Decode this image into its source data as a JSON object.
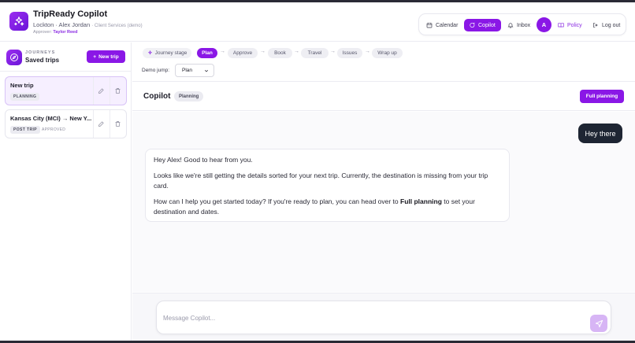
{
  "app": {
    "title": "TripReady Copilot",
    "org": "Lockton · Alex Jordan",
    "dept": "· Client Services (demo)",
    "approver_label": "Approver:",
    "approver_name": "Taylor Reed"
  },
  "nav": {
    "calendar": "Calendar",
    "copilot": "Copilot",
    "inbox": "Inbox",
    "avatar_initial": "A",
    "policy": "Policy",
    "logout": "Log out"
  },
  "sidebar": {
    "kicker": "JOURNEYS",
    "title": "Saved trips",
    "new_trip_label": "New trip",
    "trips": [
      {
        "name": "New trip",
        "badge": "PLANNING",
        "status": ""
      },
      {
        "name": "Kansas City (MCI) → New Y...",
        "badge": "POST TRIP",
        "status": "APPROVED"
      }
    ]
  },
  "stages": {
    "label": "Journey stage",
    "items": [
      "Plan",
      "Approve",
      "Book",
      "Travel",
      "Issues",
      "Wrap up"
    ],
    "active": "Plan",
    "arrow": "→"
  },
  "demo_jump": {
    "label": "Demo jump:",
    "selected": "Plan"
  },
  "copilot": {
    "title": "Copilot",
    "badge": "Planning",
    "full_planning_label": "Full planning"
  },
  "chat": {
    "user_message": "Hey there",
    "bot_line_1": "Hey Alex! Good to hear from you.",
    "bot_line_2": "Looks like we're still getting the details sorted for your next trip. Currently, the destination is missing from your trip card.",
    "bot_line_3_pre": "How can I help you get started today? If you're ready to plan, you can head over to ",
    "bot_line_3_bold": "Full planning",
    "bot_line_3_post": " to set your destination and dates."
  },
  "composer": {
    "placeholder": "Message Copilot..."
  },
  "colors": {
    "accent": "#8a17e6",
    "dark_bubble": "#1e2533"
  }
}
